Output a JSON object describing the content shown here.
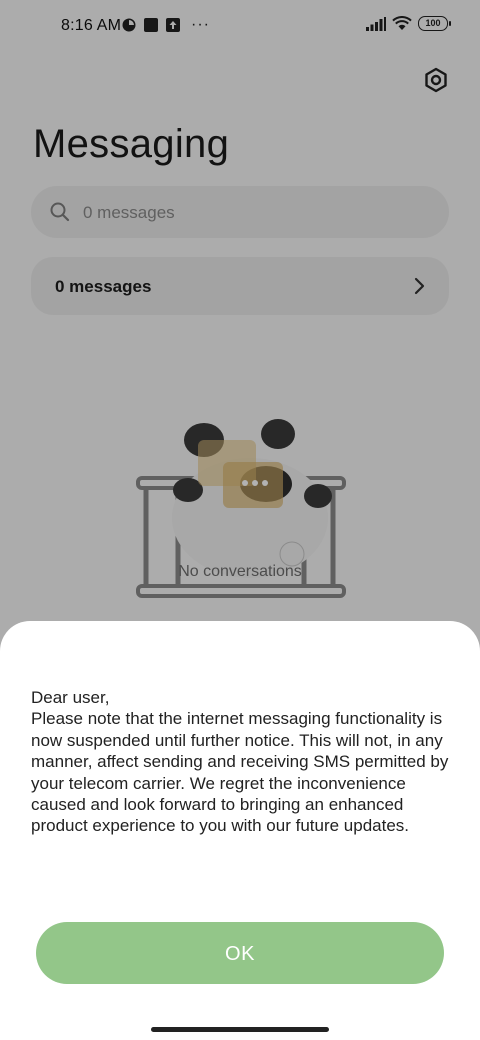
{
  "status_bar": {
    "time": "8:16 AM",
    "more": "···",
    "battery": "100"
  },
  "app": {
    "title": "Messaging",
    "search_placeholder": "0 messages",
    "messages_card_label": "0 messages",
    "empty_state": "No conversations"
  },
  "dialog": {
    "message": "Dear user,\nPlease note that the internet messaging functionality is now suspended until further notice. This will not, in any manner, affect sending and receiving SMS permitted by your telecom carrier. We regret the inconvenience caused and look forward to bringing an enhanced product experience to you with our future updates.",
    "ok_label": "OK"
  },
  "colors": {
    "ok_button": "#93c689",
    "scrim": "rgba(0,0,0,0.30)"
  },
  "icons": [
    "data-saver-icon",
    "square-notification-icon",
    "upload-icon",
    "signal-icon",
    "wifi-icon",
    "battery-icon",
    "settings-icon",
    "search-icon",
    "chevron-right-icon"
  ]
}
